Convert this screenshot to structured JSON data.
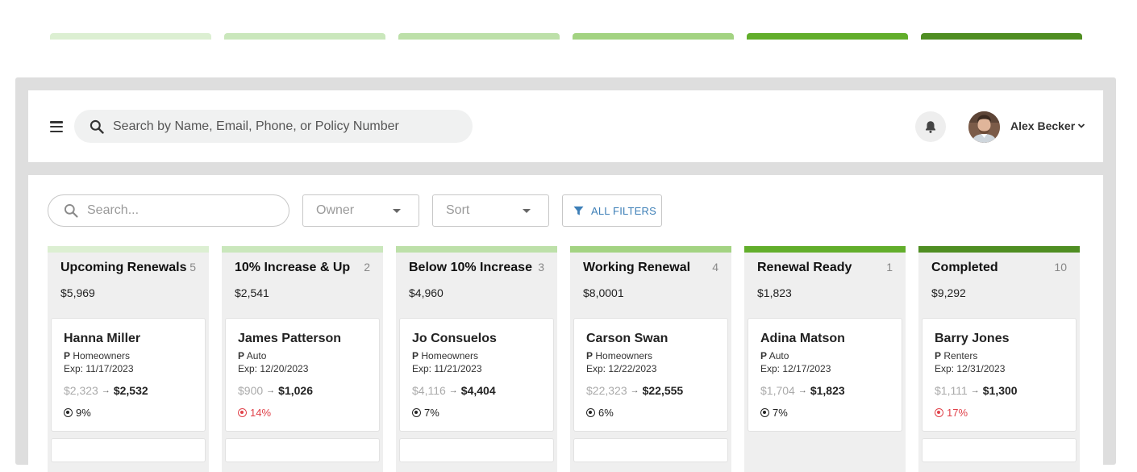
{
  "colors": {
    "stage_1": "#dcefd2",
    "stage_2": "#cae7bc",
    "stage_3": "#bde0a9",
    "stage_4": "#a3d382",
    "stage_5": "#62ae2b",
    "stage_6": "#4f8e22"
  },
  "header": {
    "search_placeholder": "Search by Name, Email, Phone, or Policy Number",
    "user_name": "Alex Becker"
  },
  "filters": {
    "search_placeholder": "Search...",
    "owner_label": "Owner",
    "sort_label": "Sort",
    "all_filters_label": "ALL FILTERS"
  },
  "columns": [
    {
      "title": "Upcoming Renewals",
      "count": "5",
      "total": "$5,969",
      "card": {
        "name": "Hanna Miller",
        "type_prefix": "P",
        "type": "Homeowners",
        "exp": "Exp: 11/17/2023",
        "old_price": "$2,323",
        "new_price": "$2,532",
        "pct": "9%",
        "pct_alert": false
      }
    },
    {
      "title": "10% Increase & Up",
      "count": "2",
      "total": "$2,541",
      "card": {
        "name": "James Patterson",
        "type_prefix": "P",
        "type": "Auto",
        "exp": "Exp: 12/20/2023",
        "old_price": "$900",
        "new_price": "$1,026",
        "pct": "14%",
        "pct_alert": true
      }
    },
    {
      "title": "Below 10% Increase",
      "count": "3",
      "total": "$4,960",
      "card": {
        "name": "Jo Consuelos",
        "type_prefix": "P",
        "type": "Homeowners",
        "exp": "Exp: 11/21/2023",
        "old_price": "$4,116",
        "new_price": "$4,404",
        "pct": "7%",
        "pct_alert": false
      }
    },
    {
      "title": "Working Renewal",
      "count": "4",
      "total": "$8,0001",
      "card": {
        "name": "Carson Swan",
        "type_prefix": "P",
        "type": "Homeowners",
        "exp": "Exp: 12/22/2023",
        "old_price": "$22,323",
        "new_price": "$22,555",
        "pct": "6%",
        "pct_alert": false
      }
    },
    {
      "title": "Renewal Ready",
      "count": "1",
      "total": "$1,823",
      "card": {
        "name": "Adina Matson",
        "type_prefix": "P",
        "type": "Auto",
        "exp": "Exp: 12/17/2023",
        "old_price": "$1,704",
        "new_price": "$1,823",
        "pct": "7%",
        "pct_alert": false
      }
    },
    {
      "title": "Completed",
      "count": "10",
      "total": "$9,292",
      "card": {
        "name": "Barry Jones",
        "type_prefix": "P",
        "type": "Renters",
        "exp": "Exp: 12/31/2023",
        "old_price": "$1,111",
        "new_price": "$1,300",
        "pct": "17%",
        "pct_alert": true
      }
    }
  ]
}
